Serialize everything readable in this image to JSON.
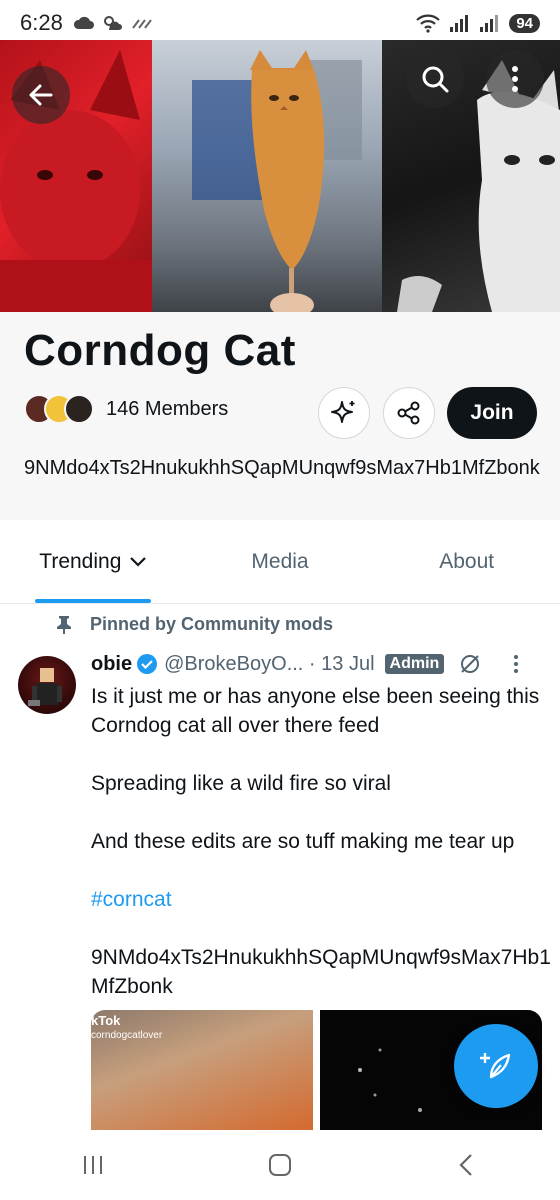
{
  "status_bar": {
    "time": "6:28",
    "battery": "94"
  },
  "community": {
    "title": "Corndog Cat",
    "members_text": "146 Members",
    "join_label": "Join",
    "description": "9NMdo4xTs2HnukukhhSQapMUnqwf9sMax7Hb1MfZbonk"
  },
  "tabs": [
    {
      "label": "Trending",
      "active": true
    },
    {
      "label": "Media",
      "active": false
    },
    {
      "label": "About",
      "active": false
    }
  ],
  "post": {
    "pinned_label": "Pinned by Community mods",
    "author_name": "obie",
    "handle_date": "@BrokeBoyO... · 13 Jul",
    "badge": "Admin",
    "paragraphs": [
      "Is it just me or has anyone else been seeing this Corndog cat all over there feed",
      "Spreading like a wild fire so viral",
      "And these edits are so tuff making me tear up"
    ],
    "hashtag": "#corncat",
    "address": "9NMdo4xTs2HnukukhhSQapMUnqwf9sMax7Hb1MfZbonk",
    "media_label": "kTok",
    "media_user": "corndogcatlover"
  },
  "colors": {
    "accent": "#1d9bf0",
    "text": "#0f1419",
    "muted": "#536471"
  }
}
